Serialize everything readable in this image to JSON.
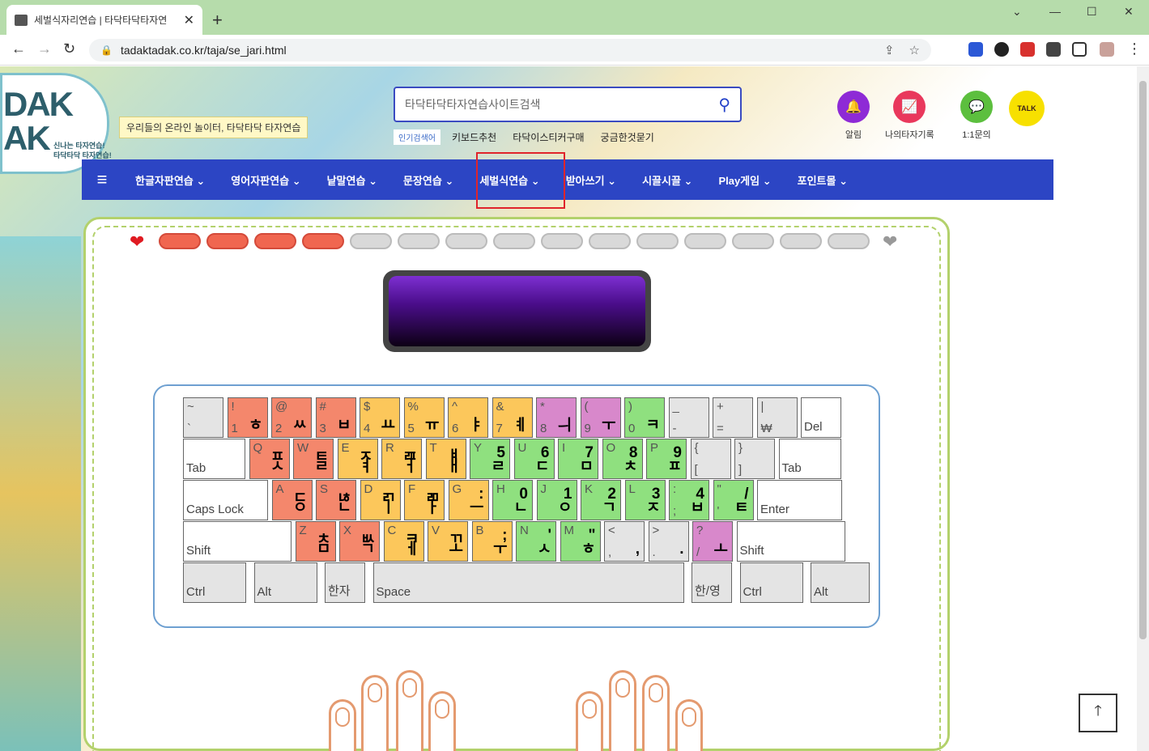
{
  "browser": {
    "tab_title": "세벌식자리연습 | 타닥타닥타자연",
    "close": "✕",
    "new_tab": "+",
    "url": "tadaktadak.co.kr/taja/se_jari.html",
    "win_min": "⌄",
    "win_minimize": "—",
    "win_max": "☐",
    "win_close": "✕"
  },
  "site": {
    "logo_text": "DAK\nAK",
    "logo_small": "신나는 타자연습!\n타닥타닥 타자연습!",
    "tagline": "우리들의 온라인 놀이터, 타닥타닥 타자연습",
    "search_placeholder": "타닥타닥타자연습사이트검색",
    "popular_label": "인기검색어",
    "popular": [
      "키보드추천",
      "타닥이스티커구매",
      "궁금한것묻기"
    ],
    "top_icons": [
      {
        "label": "알림",
        "icon": "bell-icon",
        "color": "#8e2ad6"
      },
      {
        "label": "나의타자기록",
        "icon": "chart-icon",
        "color": "#e9385c"
      },
      {
        "label": "1:1문의",
        "icon": "chat-icon",
        "color": "#5cbf3e"
      },
      {
        "label": "",
        "icon": "kakao-talk-icon",
        "color": "#f7e000",
        "badge": "TALK"
      }
    ],
    "nav": [
      "한글자판연습",
      "영어자판연습",
      "낱말연습",
      "문장연습",
      "세벌식연습",
      "받아쓰기",
      "시끌시끌",
      "Play게임",
      "포인트몰"
    ],
    "nav_menu_icon": "≡",
    "chevron": "⌄"
  },
  "game": {
    "lives_filled": 4,
    "lives_total": 15,
    "heart_full": "❤",
    "heart_empty": "❤"
  },
  "keyboard": {
    "row1": [
      {
        "shift": "~",
        "base": "`",
        "k1": "",
        "k2": "",
        "color": "gray"
      },
      {
        "shift": "!",
        "base": "1",
        "k1": "",
        "k2": "ㅎ",
        "color": "red"
      },
      {
        "shift": "@",
        "base": "2",
        "k1": "",
        "k2": "ㅆ",
        "color": "red"
      },
      {
        "shift": "#",
        "base": "3",
        "k1": "",
        "k2": "ㅂ",
        "color": "red"
      },
      {
        "shift": "$",
        "base": "4",
        "k1": "",
        "k2": "ㅛ",
        "color": "orange"
      },
      {
        "shift": "%",
        "base": "5",
        "k1": "",
        "k2": "ㅠ",
        "color": "orange"
      },
      {
        "shift": "^",
        "base": "6",
        "k1": "",
        "k2": "ㅑ",
        "color": "orange"
      },
      {
        "shift": "&",
        "base": "7",
        "k1": "",
        "k2": "ㅖ",
        "color": "orange"
      },
      {
        "shift": "*",
        "base": "8",
        "k1": "",
        "k2": "ㅢ",
        "color": "pink"
      },
      {
        "shift": "(",
        "base": "9",
        "k1": "",
        "k2": "ㅜ",
        "color": "pink"
      },
      {
        "shift": ")",
        "base": "0",
        "k1": "",
        "k2": "ㅋ",
        "color": "green"
      },
      {
        "shift": "_",
        "base": "-",
        "k1": "",
        "k2": "",
        "color": "gray"
      },
      {
        "shift": "+",
        "base": "=",
        "k1": "",
        "k2": "",
        "color": "gray"
      },
      {
        "shift": "|",
        "base": "₩",
        "k1": "",
        "k2": "",
        "color": "gray"
      },
      {
        "fn": "Del",
        "color": "white"
      }
    ],
    "row2": [
      {
        "fn": "Tab",
        "color": "white"
      },
      {
        "shift": "Q",
        "base": "",
        "k1": "ㅍ",
        "k2": "ㅅ",
        "color": "red"
      },
      {
        "shift": "W",
        "base": "",
        "k1": "ㅌ",
        "k2": "ㄹ",
        "color": "red"
      },
      {
        "shift": "E",
        "base": "",
        "k1": "ㅈ",
        "k2": "ㅕ",
        "color": "orange"
      },
      {
        "shift": "R",
        "base": "",
        "k1": "ㄿ",
        "k2": "ㅓ",
        "color": "orange"
      },
      {
        "shift": "T",
        "base": "",
        "k1": "ㅒ",
        "k2": "ㅐ",
        "color": "orange"
      },
      {
        "shift": "Y",
        "base": "",
        "k1": "5",
        "k2": "ㄹ",
        "color": "green"
      },
      {
        "shift": "U",
        "base": "",
        "k1": "6",
        "k2": "ㄷ",
        "color": "green"
      },
      {
        "shift": "I",
        "base": "",
        "k1": "7",
        "k2": "ㅁ",
        "color": "green"
      },
      {
        "shift": "O",
        "base": "",
        "k1": "8",
        "k2": "ㅊ",
        "color": "green"
      },
      {
        "shift": "P",
        "base": "",
        "k1": "9",
        "k2": "ㅍ",
        "color": "green"
      },
      {
        "shift": "{",
        "base": "[",
        "k1": "",
        "k2": "",
        "color": "gray"
      },
      {
        "shift": "}",
        "base": "]",
        "k1": "",
        "k2": "",
        "color": "gray"
      },
      {
        "fn": "Tab",
        "color": "white"
      }
    ],
    "row3": [
      {
        "fn": "Caps Lock",
        "color": "white"
      },
      {
        "shift": "A",
        "base": "",
        "k1": "ㄷ",
        "k2": "ㅇ",
        "color": "red"
      },
      {
        "shift": "S",
        "base": "",
        "k1": "ㄶ",
        "k2": "ㄴ",
        "color": "red"
      },
      {
        "shift": "D",
        "base": "",
        "k1": "ㄺ",
        "k2": "ㅣ",
        "color": "orange"
      },
      {
        "shift": "F",
        "base": "",
        "k1": "ㄻ",
        "k2": "ㅏ",
        "color": "orange"
      },
      {
        "shift": "G",
        "base": "",
        "k1": ":",
        "k2": "ㅡ",
        "color": "orange"
      },
      {
        "shift": "H",
        "base": "",
        "k1": "0",
        "k2": "ㄴ",
        "color": "green"
      },
      {
        "shift": "J",
        "base": "",
        "k1": "1",
        "k2": "ㅇ",
        "color": "green"
      },
      {
        "shift": "K",
        "base": "",
        "k1": "2",
        "k2": "ㄱ",
        "color": "green"
      },
      {
        "shift": "L",
        "base": "",
        "k1": "3",
        "k2": "ㅈ",
        "color": "green"
      },
      {
        "shift": ":",
        "base": ";",
        "k1": "4",
        "k2": "ㅂ",
        "color": "green"
      },
      {
        "shift": "\"",
        "base": "'",
        "k1": "/",
        "k2": "ㅌ",
        "color": "green"
      },
      {
        "fn": "Enter",
        "color": "white"
      }
    ],
    "row4": [
      {
        "fn": "Shift",
        "color": "white"
      },
      {
        "shift": "Z",
        "base": "",
        "k1": "ㅊ",
        "k2": "ㅁ",
        "color": "red"
      },
      {
        "shift": "X",
        "base": "",
        "k1": "ㅄ",
        "k2": "ㄱ",
        "color": "red"
      },
      {
        "shift": "C",
        "base": "",
        "k1": "ㅋ",
        "k2": "ㅔ",
        "color": "orange"
      },
      {
        "shift": "V",
        "base": "",
        "k1": "ㄲ",
        "k2": "ㅗ",
        "color": "orange"
      },
      {
        "shift": "B",
        "base": "",
        "k1": ";",
        "k2": "ㅜ",
        "color": "orange"
      },
      {
        "shift": "N",
        "base": "",
        "k1": "'",
        "k2": "ㅅ",
        "color": "green"
      },
      {
        "shift": "M",
        "base": "",
        "k1": "\"",
        "k2": "ㅎ",
        "color": "green"
      },
      {
        "shift": "<",
        "base": ",",
        "k1": "",
        "k2": ",",
        "color": "gray"
      },
      {
        "shift": ">",
        "base": ".",
        "k1": "",
        "k2": ".",
        "color": "gray"
      },
      {
        "shift": "?",
        "base": "/",
        "k1": "",
        "k2": "ㅗ",
        "color": "pink"
      },
      {
        "fn": "Shift",
        "color": "white"
      }
    ],
    "row5": [
      {
        "fn": "Ctrl",
        "color": "gray"
      },
      {
        "fn": "Alt",
        "color": "gray"
      },
      {
        "fn": "한자",
        "color": "gray"
      },
      {
        "fn": "Space",
        "color": "gray"
      },
      {
        "fn": "한/영",
        "color": "gray"
      },
      {
        "fn": "Ctrl",
        "color": "gray"
      },
      {
        "fn": "Alt",
        "color": "gray"
      }
    ]
  },
  "back_to_top": "🡑",
  "colors": {
    "nav": "#2c45c4",
    "highlight": "#e0242b",
    "frame": "#b3d16c"
  }
}
